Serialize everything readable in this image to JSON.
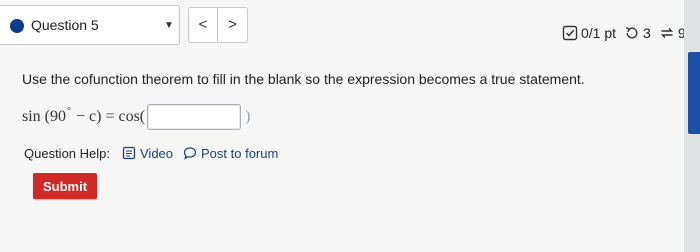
{
  "question_selector": {
    "label": "Question 5"
  },
  "nav": {
    "prev": "<",
    "next": ">"
  },
  "score": {
    "points": "0/1 pt",
    "retries": "3",
    "submissions": "9"
  },
  "question": {
    "instructions": "Use the cofunction theorem to fill in the blank so the expression becomes a true statement.",
    "expression": {
      "lhs_start": "sin (90",
      "degree": "°",
      "lhs_end": " − c) = cos(",
      "answer_value": "",
      "close": ")"
    }
  },
  "help": {
    "label": "Question Help:",
    "video": "Video",
    "forum": "Post to forum"
  },
  "submit_label": "Submit",
  "colors": {
    "accent": "#0d3b8a",
    "submit": "#cf2a27",
    "link": "#1c3f7a"
  }
}
